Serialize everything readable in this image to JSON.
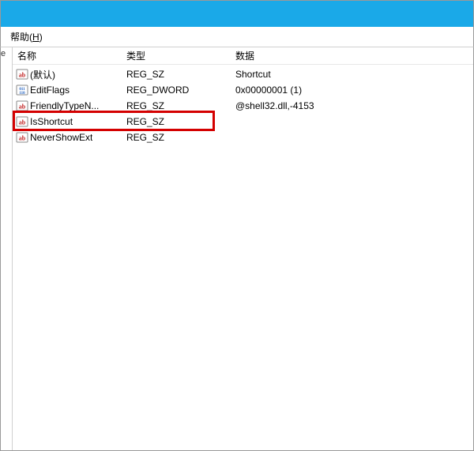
{
  "menubar": {
    "help_label": "帮助",
    "help_hotkey": "H"
  },
  "left_pane_fragment": "e",
  "columns": {
    "name": "名称",
    "type": "类型",
    "data": "数据"
  },
  "rows": [
    {
      "icon": "string",
      "name": "(默认)",
      "type": "REG_SZ",
      "data": "Shortcut"
    },
    {
      "icon": "binary",
      "name": "EditFlags",
      "type": "REG_DWORD",
      "data": "0x00000001 (1)"
    },
    {
      "icon": "string",
      "name": "FriendlyTypeN...",
      "type": "REG_SZ",
      "data": "@shell32.dll,-4153"
    },
    {
      "icon": "string",
      "name": "IsShortcut",
      "type": "REG_SZ",
      "data": ""
    },
    {
      "icon": "string",
      "name": "NeverShowExt",
      "type": "REG_SZ",
      "data": ""
    }
  ],
  "highlight_row_index": 3,
  "colors": {
    "titlebar": "#1aa9e8",
    "highlight_border": "#d40000"
  }
}
